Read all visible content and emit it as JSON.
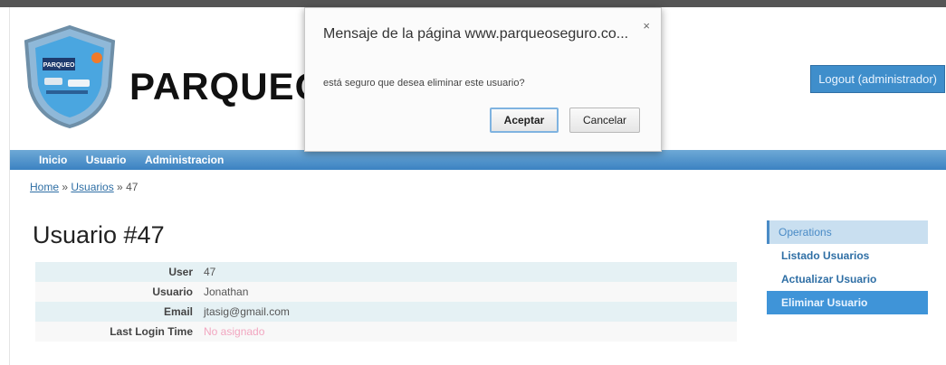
{
  "header": {
    "site_title": "PARQUEO S",
    "logo_text": "PARQUEO SEGURO",
    "logout_label": "Logout (administrador)"
  },
  "menu": {
    "items": [
      "Inicio",
      "Usuario",
      "Administracion"
    ]
  },
  "breadcrumb": {
    "home": "Home",
    "sep1": " » ",
    "section": "Usuarios",
    "sep2": " » ",
    "current": "47"
  },
  "page": {
    "title": "Usuario #47"
  },
  "detail": {
    "rows": [
      {
        "label": "User",
        "value": "47"
      },
      {
        "label": "Usuario",
        "value": "Jonathan"
      },
      {
        "label": "Email",
        "value": "jtasig@gmail.com"
      },
      {
        "label": "Last Login Time",
        "value": "No asignado"
      }
    ]
  },
  "operations": {
    "title": "Operations",
    "items": [
      "Listado Usuarios",
      "Actualizar Usuario",
      "Eliminar Usuario"
    ]
  },
  "dialog": {
    "title": "Mensaje de la página www.parqueoseguro.co...",
    "close": "×",
    "message": "está seguro que desea eliminar este usuario?",
    "ok_label": "Aceptar",
    "cancel_label": "Cancelar"
  },
  "colors": {
    "menu_blue": "#3b82c2",
    "accent_blue": "#3f94d8",
    "row_alt": "#e5f1f4"
  }
}
